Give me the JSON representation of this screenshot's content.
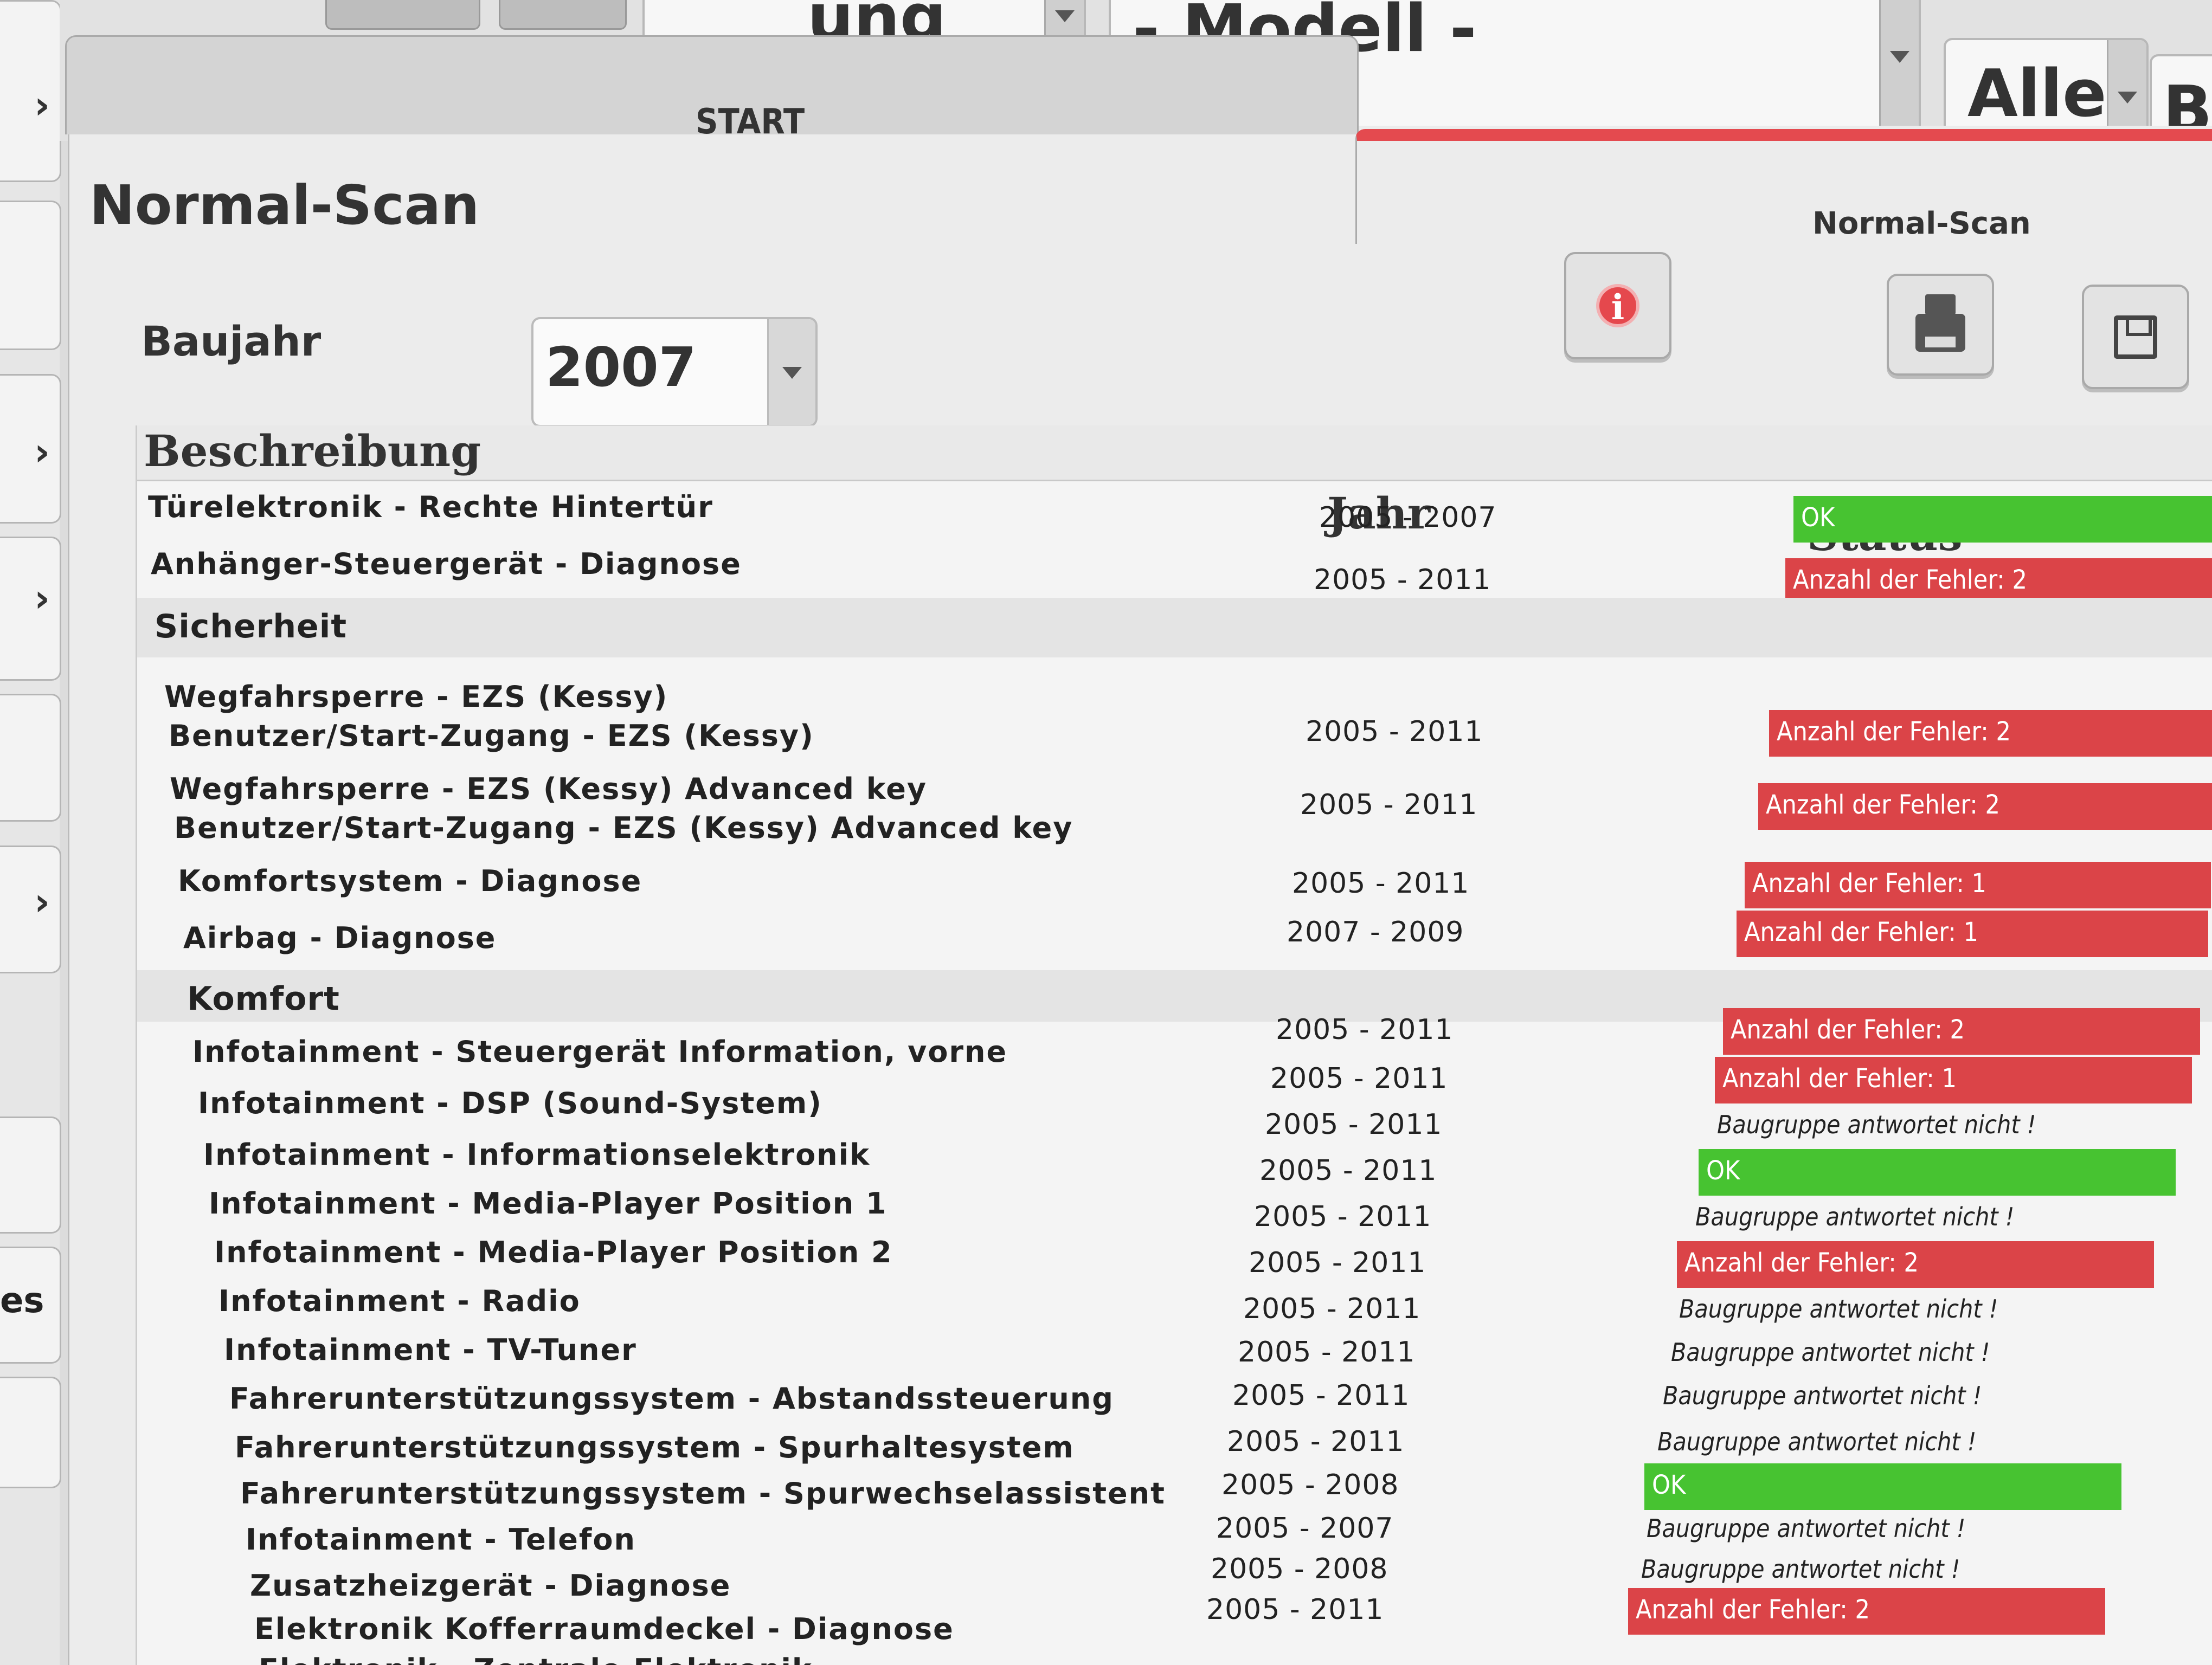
{
  "top": {
    "partial_select_text": "ung",
    "modell_select_text": "- Modell -",
    "alle_select_text": "Alle",
    "partial_button_text": "Be"
  },
  "tabs": {
    "start_label": "START",
    "scan_label": "Normal-Scan"
  },
  "page": {
    "title": "Normal-Scan",
    "year_label": "Baujahr",
    "year_value": "2007"
  },
  "table": {
    "headers": {
      "description": "Beschreibung",
      "year": "Jahr",
      "status": "Status"
    },
    "rows": [
      {
        "desc": "Türelektronik - Rechte Hintertür",
        "year": "2005 - 2007",
        "status": "OK",
        "type": "ok"
      },
      {
        "desc": "Anhänger-Steuergerät - Diagnose",
        "year": "2005 - 2011",
        "status": "Anzahl der Fehler: 2",
        "type": "err"
      },
      {
        "section": "Sicherheit"
      },
      {
        "desc": "Wegfahrsperre - EZS (Kessy)",
        "desc2": "Benutzer/Start-Zugang - EZS (Kessy)",
        "year": "2005 - 2011",
        "status": "Anzahl der Fehler: 2",
        "type": "err"
      },
      {
        "desc": "Wegfahrsperre - EZS (Kessy) Advanced key",
        "desc2": "Benutzer/Start-Zugang - EZS (Kessy) Advanced key",
        "year": "2005 - 2011",
        "status": "Anzahl der Fehler: 2",
        "type": "err"
      },
      {
        "desc": "Komfortsystem - Diagnose",
        "year": "2005 - 2011",
        "status": "Anzahl der Fehler: 1",
        "type": "err"
      },
      {
        "desc": "Airbag - Diagnose",
        "year": "2007 - 2009",
        "status": "Anzahl der Fehler: 1",
        "type": "err"
      },
      {
        "section": "Komfort"
      },
      {
        "desc": "Infotainment - Steuergerät Information, vorne",
        "year": "2005 - 2011",
        "status": "Anzahl der Fehler: 2",
        "type": "err"
      },
      {
        "desc": "Infotainment - DSP (Sound-System)",
        "year": "2005 - 2011",
        "status": "Anzahl der Fehler: 1",
        "type": "err"
      },
      {
        "desc": "Infotainment - Informationselektronik",
        "year": "2005 - 2011",
        "status": "Baugruppe antwortet nicht !",
        "type": "none"
      },
      {
        "desc": "Infotainment - Media-Player Position 1",
        "year": "2005 - 2011",
        "status": "OK",
        "type": "ok"
      },
      {
        "desc": "Infotainment - Media-Player Position 2",
        "year": "2005 - 2011",
        "status": "Baugruppe antwortet nicht !",
        "type": "none"
      },
      {
        "desc": "Infotainment - Radio",
        "year": "2005 - 2011",
        "status": "Anzahl der Fehler: 2",
        "type": "err"
      },
      {
        "desc": "Infotainment - TV-Tuner",
        "year": "2005 - 2011",
        "status": "Baugruppe antwortet nicht !",
        "type": "none"
      },
      {
        "desc": "Fahrerunterstützungssystem - Abstandssteuerung",
        "year": "2005 - 2011",
        "status": "Baugruppe antwortet nicht !",
        "type": "none"
      },
      {
        "desc": "Fahrerunterstützungssystem - Spurhaltesystem",
        "year": "2005 - 2011",
        "status": "Baugruppe antwortet nicht !",
        "type": "none"
      },
      {
        "desc": "Fahrerunterstützungssystem - Spurwechselassistent",
        "year": "2005 - 2011",
        "status": "Baugruppe antwortet nicht !",
        "type": "none"
      },
      {
        "desc": "Infotainment - Telefon",
        "year": "2005 - 2008",
        "status": "OK",
        "type": "ok"
      },
      {
        "desc": "Zusatzheizgerät - Diagnose",
        "year": "2005 - 2007",
        "status": "Baugruppe antwortet nicht !",
        "type": "none"
      },
      {
        "desc": "Elektronik Kofferraumdeckel - Diagnose",
        "year": "2005 - 2008",
        "status": "Baugruppe antwortet nicht !",
        "type": "none"
      },
      {
        "desc": "Elektronik - Zentrale Elektronik",
        "year": "2005 - 2011",
        "status": "Anzahl der Fehler: 2",
        "type": "err"
      }
    ]
  },
  "left": {
    "partial_text": "es"
  },
  "colors": {
    "ok": "#47c331",
    "error": "#db4448",
    "tab_accent": "#e44a4f"
  }
}
